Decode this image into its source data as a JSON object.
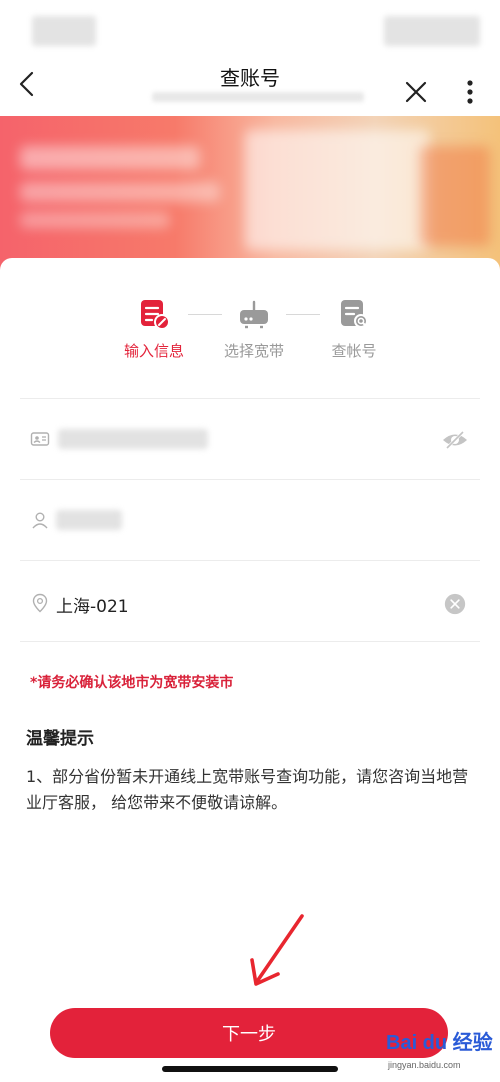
{
  "header": {
    "title": "查账号"
  },
  "steps": [
    {
      "label": "输入信息",
      "icon": "edit-document-icon",
      "state": "active"
    },
    {
      "label": "选择宽带",
      "icon": "router-icon",
      "state": "inactive"
    },
    {
      "label": "查帐号",
      "icon": "search-document-icon",
      "state": "inactive"
    }
  ],
  "form": {
    "id_card": {
      "icon": "id-card-icon",
      "trailing_icon": "eye-hidden-icon"
    },
    "name": {
      "icon": "user-icon"
    },
    "location": {
      "icon": "location-pin-icon",
      "value": "上海-021",
      "trailing_icon": "clear-icon"
    }
  },
  "warning": "*请务必确认该地市为宽带安装市",
  "tips": {
    "title": "温馨提示",
    "body": "1、部分省份暂未开通线上宽带账号查询功能，请您咨询当地营业厅客服， 给您带来不便敬请谅解。"
  },
  "next_button": "下一步",
  "watermark": {
    "brand": "Bai du 经验",
    "url": "jingyan.baidu.com"
  },
  "colors": {
    "accent": "#e3223a",
    "inactive": "#9a9a9a"
  }
}
